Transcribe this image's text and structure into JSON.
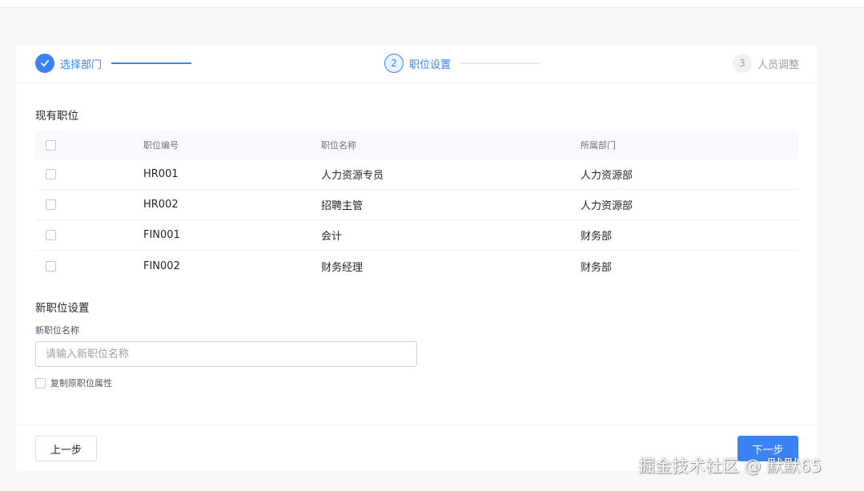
{
  "steps": [
    {
      "number": "",
      "label": "选择部门",
      "state": "done",
      "icon": "check-icon"
    },
    {
      "number": "2",
      "label": "职位设置",
      "state": "active"
    },
    {
      "number": "3",
      "label": "人员调整",
      "state": "pending"
    }
  ],
  "existing": {
    "title": "现有职位",
    "columns": [
      "职位编号",
      "职位名称",
      "所属部门"
    ],
    "rows": [
      {
        "code": "HR001",
        "name": "人力资源专员",
        "dept": "人力资源部"
      },
      {
        "code": "HR002",
        "name": "招聘主管",
        "dept": "人力资源部"
      },
      {
        "code": "FIN001",
        "name": "会计",
        "dept": "财务部"
      },
      {
        "code": "FIN002",
        "name": "财务经理",
        "dept": "财务部"
      }
    ]
  },
  "new_position": {
    "title": "新职位设置",
    "field_label": "新职位名称",
    "placeholder": "请输入新职位名称",
    "value": "",
    "copy_label": "复制原职位属性"
  },
  "footer": {
    "prev_label": "上一步",
    "next_label": "下一步"
  },
  "watermark": "掘金技术社区 @ 默默65",
  "colors": {
    "accent": "#3b82f6",
    "muted": "#9aa0a6"
  }
}
